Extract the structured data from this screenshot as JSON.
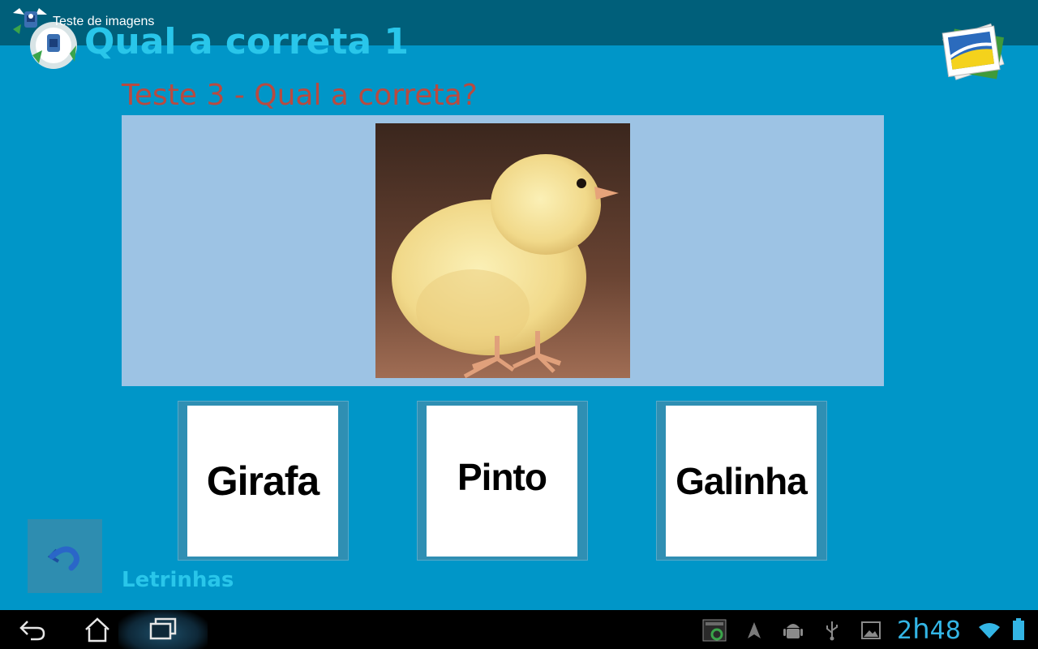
{
  "app_bar": {
    "title": "Teste de imagens",
    "icons": [
      "app-icon",
      "photos-icon"
    ]
  },
  "header": {
    "title": "Qual a correta 1"
  },
  "question": {
    "text": "Teste 3 - Qual a correta?",
    "image": "chick-photo"
  },
  "answers": [
    {
      "label": "Girafa"
    },
    {
      "label": "Pinto"
    },
    {
      "label": "Galinha"
    }
  ],
  "footer": {
    "back_icon": "undo-arrow-icon",
    "letrinhas_label": "Letrinhas"
  },
  "system_bar": {
    "nav_icons": [
      "back-icon",
      "home-icon",
      "recent-apps-icon"
    ],
    "status_icons": [
      "screenshot-icon",
      "navigation-icon",
      "android-debug-icon",
      "usb-icon",
      "gallery-icon",
      "wifi-icon",
      "battery-icon"
    ],
    "time_hours": "2",
    "time_h": "h",
    "time_minutes": "48"
  },
  "colors": {
    "background": "#0096c8",
    "top_bar": "#005f7a",
    "header_title": "#29c6ea",
    "question_text": "#b94a40",
    "image_panel": "#9dc3e4",
    "answer_border": "#2f8fb3",
    "clock": "#33b5e5"
  }
}
